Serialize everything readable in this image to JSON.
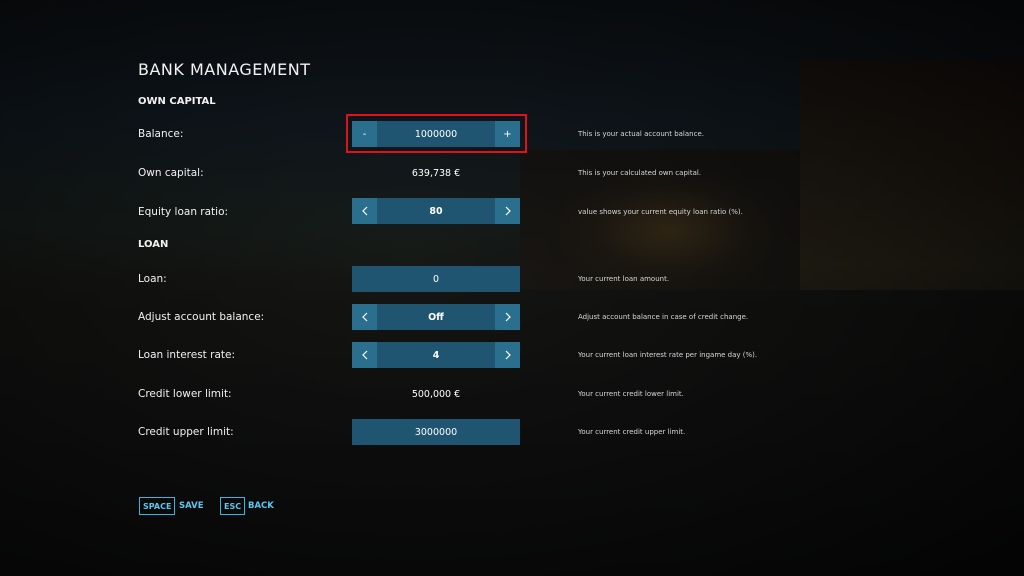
{
  "title": "BANK MANAGEMENT",
  "sections": {
    "own_capital": "OWN CAPITAL",
    "loan": "LOAN"
  },
  "rows": {
    "balance": {
      "label": "Balance:",
      "minus": "-",
      "value": "1000000",
      "plus": "+",
      "desc": "This is your actual account balance."
    },
    "own_capital": {
      "label": "Own capital:",
      "value": "639,738 €",
      "desc": "This is your calculated own capital."
    },
    "equity_loan_ratio": {
      "label": "Equity loan ratio:",
      "value": "80",
      "desc": "value shows your current equity loan ratio (%)."
    },
    "loan": {
      "label": "Loan:",
      "value": "0",
      "desc": "Your current loan amount."
    },
    "adjust_account_balance": {
      "label": "Adjust account balance:",
      "value": "Off",
      "desc": "Adjust account balance in case of credit change."
    },
    "loan_interest_rate": {
      "label": "Loan interest rate:",
      "value": "4",
      "desc": "Your current loan interest rate per ingame day (%)."
    },
    "credit_lower_limit": {
      "label": "Credit lower limit:",
      "value": "500,000 €",
      "desc": "Your current credit lower limit."
    },
    "credit_upper_limit": {
      "label": "Credit upper limit:",
      "value": "3000000",
      "desc": "Your current credit upper limit."
    }
  },
  "footer": {
    "save_key": "SPACE",
    "save_label": "SAVE",
    "back_key": "ESC",
    "back_label": "BACK"
  },
  "colors": {
    "button": "#2b6f8f",
    "field": "#1f5570",
    "highlight": "#e2101b",
    "hotkey": "#5fc6ee"
  },
  "icons": {
    "left": "chevron-left-icon",
    "right": "chevron-right-icon"
  }
}
